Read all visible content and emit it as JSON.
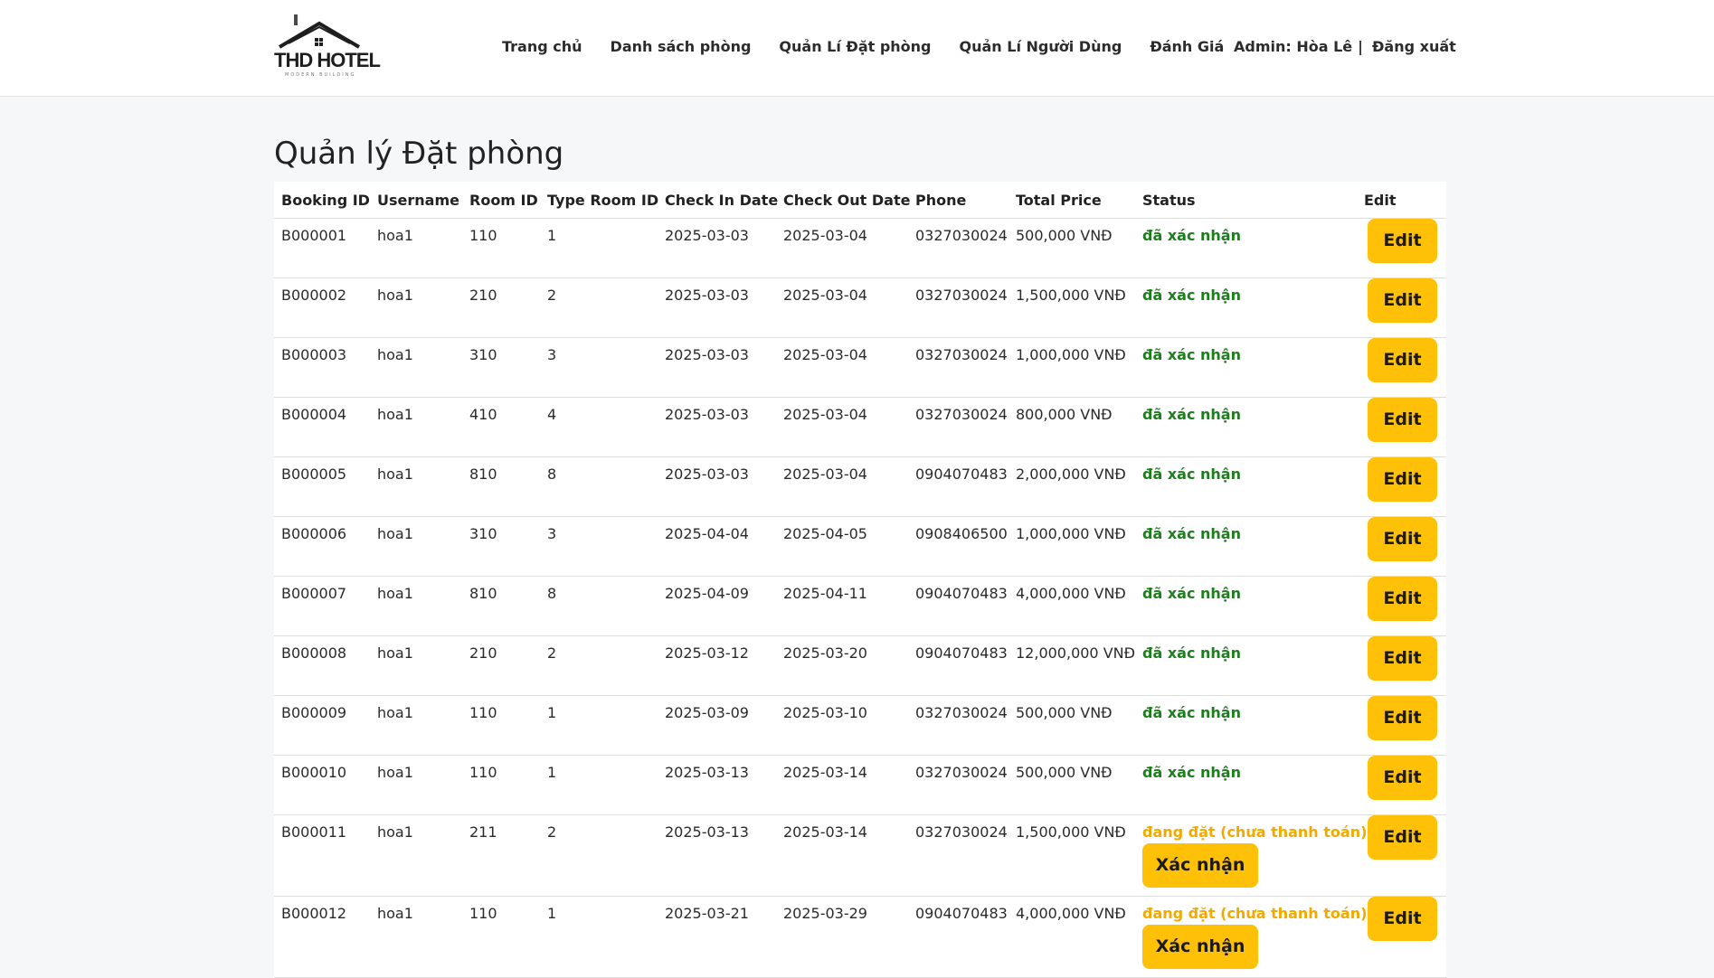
{
  "nav": {
    "logo_text": "THD HOTEL",
    "logo_sub": "MODERN BUILDING",
    "links": [
      "Trang chủ",
      "Danh sách phòng",
      "Quản Lí Đặt phòng",
      "Quản Lí Người Dùng",
      "Đánh Giá"
    ],
    "admin_label": "Admin: Hòa Lê",
    "separator": "|",
    "logout": "Đăng xuất"
  },
  "page": {
    "title": "Quản lý Đặt phòng"
  },
  "table": {
    "headers": [
      "Booking ID",
      "Username",
      "Room ID",
      "Type Room ID",
      "Check In Date",
      "Check Out Date",
      "Phone",
      "Total Price",
      "Status",
      "Edit"
    ],
    "edit_label": "Edit",
    "confirm_label": "Xác nhận",
    "rows": [
      {
        "booking_id": "B000001",
        "username": "hoa1",
        "room_id": "110",
        "type_room_id": "1",
        "check_in": "2025-03-03",
        "check_out": "2025-03-04",
        "phone": "0327030024",
        "total": "500,000 VNĐ",
        "status": "đã xác nhận",
        "pending": false
      },
      {
        "booking_id": "B000002",
        "username": "hoa1",
        "room_id": "210",
        "type_room_id": "2",
        "check_in": "2025-03-03",
        "check_out": "2025-03-04",
        "phone": "0327030024",
        "total": "1,500,000 VNĐ",
        "status": "đã xác nhận",
        "pending": false
      },
      {
        "booking_id": "B000003",
        "username": "hoa1",
        "room_id": "310",
        "type_room_id": "3",
        "check_in": "2025-03-03",
        "check_out": "2025-03-04",
        "phone": "0327030024",
        "total": "1,000,000 VNĐ",
        "status": "đã xác nhận",
        "pending": false
      },
      {
        "booking_id": "B000004",
        "username": "hoa1",
        "room_id": "410",
        "type_room_id": "4",
        "check_in": "2025-03-03",
        "check_out": "2025-03-04",
        "phone": "0327030024",
        "total": "800,000 VNĐ",
        "status": "đã xác nhận",
        "pending": false
      },
      {
        "booking_id": "B000005",
        "username": "hoa1",
        "room_id": "810",
        "type_room_id": "8",
        "check_in": "2025-03-03",
        "check_out": "2025-03-04",
        "phone": "0904070483",
        "total": "2,000,000 VNĐ",
        "status": "đã xác nhận",
        "pending": false
      },
      {
        "booking_id": "B000006",
        "username": "hoa1",
        "room_id": "310",
        "type_room_id": "3",
        "check_in": "2025-04-04",
        "check_out": "2025-04-05",
        "phone": "0908406500",
        "total": "1,000,000 VNĐ",
        "status": "đã xác nhận",
        "pending": false
      },
      {
        "booking_id": "B000007",
        "username": "hoa1",
        "room_id": "810",
        "type_room_id": "8",
        "check_in": "2025-04-09",
        "check_out": "2025-04-11",
        "phone": "0904070483",
        "total": "4,000,000 VNĐ",
        "status": "đã xác nhận",
        "pending": false
      },
      {
        "booking_id": "B000008",
        "username": "hoa1",
        "room_id": "210",
        "type_room_id": "2",
        "check_in": "2025-03-12",
        "check_out": "2025-03-20",
        "phone": "0904070483",
        "total": "12,000,000 VNĐ",
        "status": "đã xác nhận",
        "pending": false
      },
      {
        "booking_id": "B000009",
        "username": "hoa1",
        "room_id": "110",
        "type_room_id": "1",
        "check_in": "2025-03-09",
        "check_out": "2025-03-10",
        "phone": "0327030024",
        "total": "500,000 VNĐ",
        "status": "đã xác nhận",
        "pending": false
      },
      {
        "booking_id": "B000010",
        "username": "hoa1",
        "room_id": "110",
        "type_room_id": "1",
        "check_in": "2025-03-13",
        "check_out": "2025-03-14",
        "phone": "0327030024",
        "total": "500,000 VNĐ",
        "status": "đã xác nhận",
        "pending": false
      },
      {
        "booking_id": "B000011",
        "username": "hoa1",
        "room_id": "211",
        "type_room_id": "2",
        "check_in": "2025-03-13",
        "check_out": "2025-03-14",
        "phone": "0327030024",
        "total": "1,500,000 VNĐ",
        "status": "đang đặt (chưa thanh toán)",
        "pending": true
      },
      {
        "booking_id": "B000012",
        "username": "hoa1",
        "room_id": "110",
        "type_room_id": "1",
        "check_in": "2025-03-21",
        "check_out": "2025-03-29",
        "phone": "0904070483",
        "total": "4,000,000 VNĐ",
        "status": "đang đặt (chưa thanh toán)",
        "pending": true
      }
    ]
  },
  "colors": {
    "accent_button": "#ffc107",
    "status_confirmed": "#1e7e1e",
    "status_pending": "#f2a900"
  }
}
